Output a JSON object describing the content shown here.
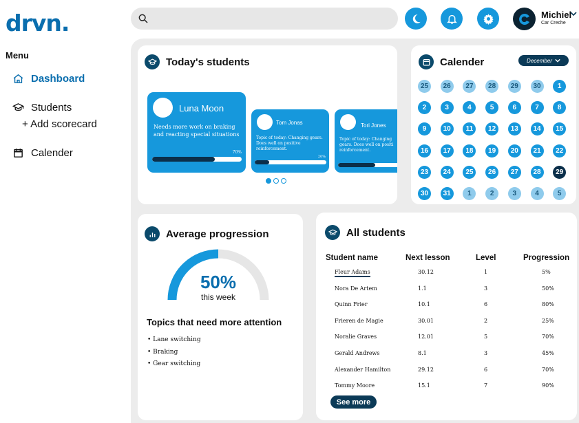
{
  "app": {
    "logo": "drvn."
  },
  "menu": {
    "title": "Menu",
    "items": [
      {
        "label": "Dashboard"
      },
      {
        "label": "Students"
      },
      {
        "label": "+ Add scorecard"
      },
      {
        "label": "Calender"
      }
    ]
  },
  "search": {
    "placeholder": ""
  },
  "user": {
    "name": "Michiel",
    "org": "Car Creche"
  },
  "today": {
    "title": "Today's students",
    "students": [
      {
        "name": "Luna Moon",
        "note": "Needs more work on braking and reacting special situations",
        "progress_label": "70%",
        "progress": 0.7
      },
      {
        "name": "Tom Jonas",
        "note": "Topic of today: Changing gears. Does well on positive reinforcement.",
        "progress_label": "20%",
        "progress": 0.2
      },
      {
        "name": "Tori Jones",
        "note": "Topic of today: Changing gears. Does well on positi reinforcement.",
        "progress_label": "",
        "progress": 0.6
      }
    ]
  },
  "calendar": {
    "title": "Calender",
    "month": "December",
    "days": [
      [
        "25",
        "26",
        "27",
        "28",
        "29",
        "30",
        "1"
      ],
      [
        "2",
        "3",
        "4",
        "5",
        "6",
        "7",
        "8"
      ],
      [
        "9",
        "10",
        "11",
        "12",
        "13",
        "14",
        "15"
      ],
      [
        "16",
        "17",
        "18",
        "19",
        "20",
        "21",
        "22"
      ],
      [
        "23",
        "24",
        "25",
        "26",
        "27",
        "28",
        "29"
      ],
      [
        "30",
        "31",
        "1",
        "2",
        "3",
        "4",
        "5"
      ]
    ]
  },
  "average": {
    "title": "Average progression",
    "value": "50%",
    "period": "this week",
    "progress": 0.5,
    "topics_title": "Topics that need more attention",
    "topics": [
      "Lane switching",
      "Braking",
      "Gear switching"
    ]
  },
  "all_students": {
    "title": "All students",
    "columns": [
      "Student name",
      "Next lesson",
      "Level",
      "Progression"
    ],
    "rows": [
      [
        "Fleur Adams",
        "30.12",
        "1",
        "5%"
      ],
      [
        "Nora De Artem",
        "1.1",
        "3",
        "50%"
      ],
      [
        "Quinn Frier",
        "10.1",
        "6",
        "80%"
      ],
      [
        "Frieren de Magie",
        "30.01",
        "2",
        "25%"
      ],
      [
        "Noralie Graves",
        "12.01",
        "5",
        "70%"
      ],
      [
        "Gerald Andrews",
        "8.1",
        "3",
        "45%"
      ],
      [
        "Alexander Hamilton",
        "29.12",
        "6",
        "70%"
      ],
      [
        "Tommy Moore",
        "15.1",
        "7",
        "90%"
      ]
    ],
    "see_more": "See more"
  },
  "colors": {
    "primary": "#1698dc",
    "dark": "#0b2f4a",
    "light": "#8fcbec",
    "logo": "#0a6eae"
  }
}
